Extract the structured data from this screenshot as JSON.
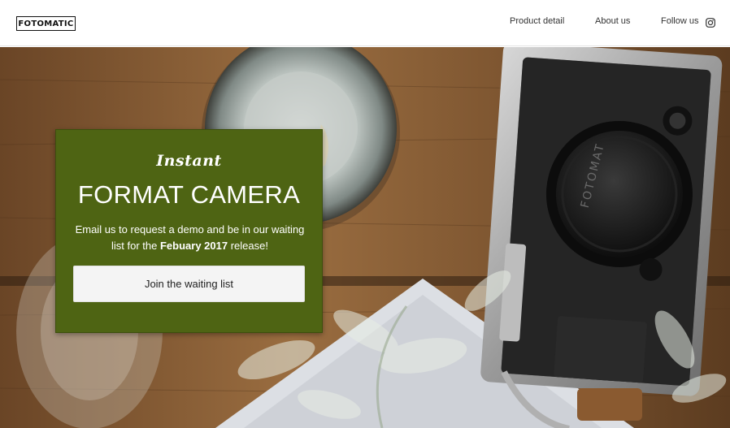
{
  "header": {
    "logo": "FOTOMATIC",
    "nav": {
      "product_detail": "Product detail",
      "about_us": "About us",
      "follow_us": "Follow us"
    },
    "social_icon": "instagram-icon"
  },
  "hero": {
    "background": "photo of vintage camera on wooden table",
    "card": {
      "script_label": "Instant",
      "title": "FORMAT CAMERA",
      "text_before": "Email us to request a demo and be in our waiting list for the ",
      "text_bold": "Febuary 2017",
      "text_after": " release!",
      "button_label": "Join the waiting list"
    },
    "lens_cap_text": "FOTOMAT"
  },
  "colors": {
    "card_bg": "#4e6413",
    "button_bg": "#f4f4f4",
    "header_bg": "#ffffff"
  }
}
